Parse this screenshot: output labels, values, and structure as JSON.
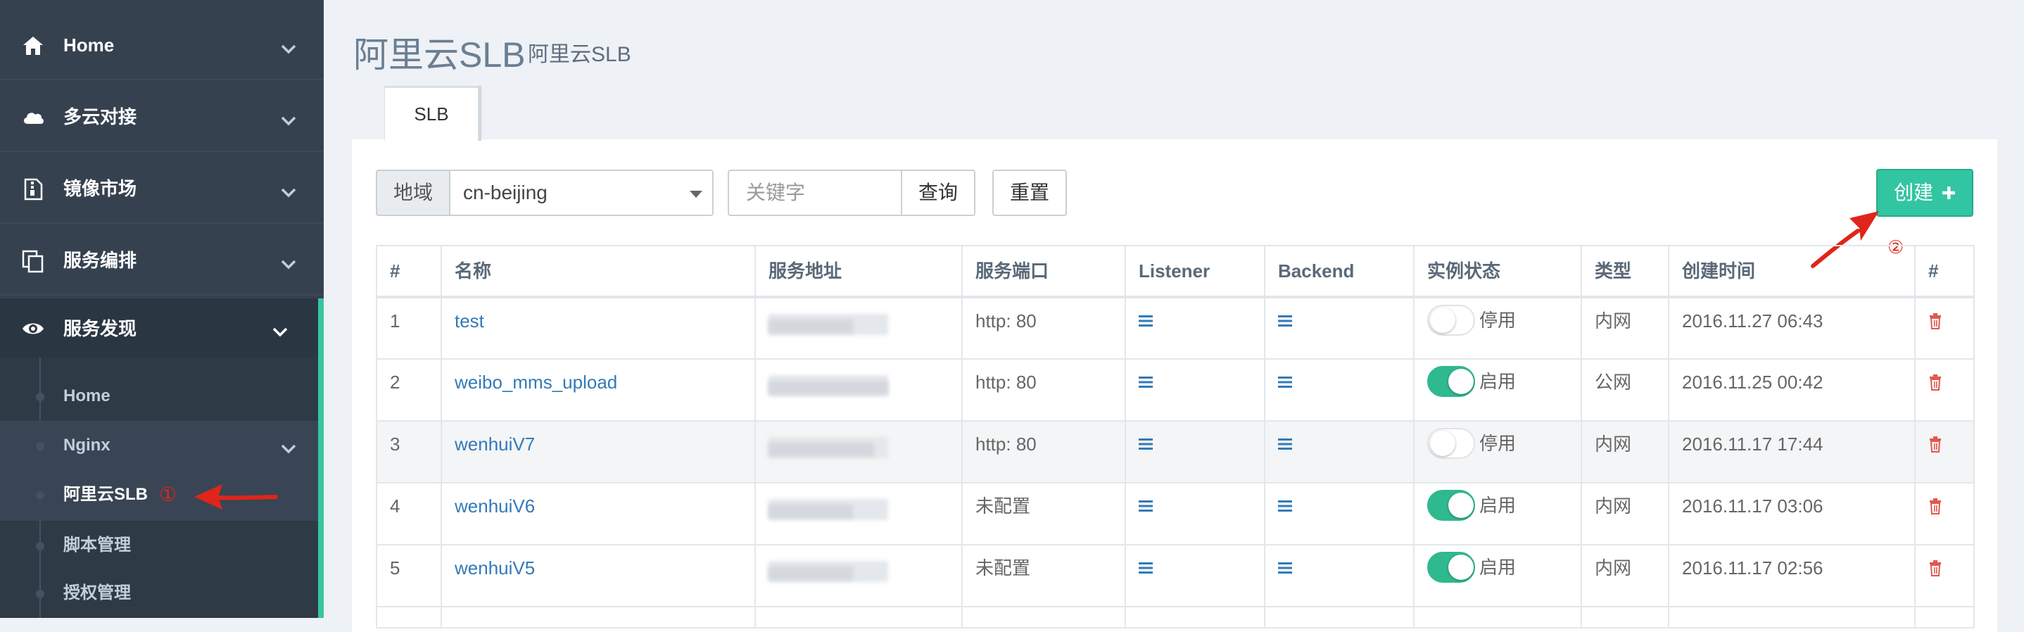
{
  "sidebar": {
    "items": [
      {
        "label": "Home",
        "icon": "home-icon"
      },
      {
        "label": "多云对接",
        "icon": "cloud-icon"
      },
      {
        "label": "镜像市场",
        "icon": "archive-icon"
      },
      {
        "label": "服务编排",
        "icon": "copy-icon"
      },
      {
        "label": "服务发现",
        "icon": "eye-icon"
      }
    ],
    "sub_items": [
      {
        "label": "Home"
      },
      {
        "label": "Nginx"
      },
      {
        "label": "阿里云SLB"
      },
      {
        "label": "脚本管理"
      },
      {
        "label": "授权管理"
      }
    ]
  },
  "annotations": {
    "marker1": "①",
    "marker2": "②"
  },
  "page": {
    "title": "阿里云SLB",
    "subtitle": "阿里云SLB"
  },
  "tabs": [
    {
      "label": "SLB"
    }
  ],
  "filters": {
    "region_label": "地域",
    "region_value": "cn-beijing",
    "keyword_placeholder": "关键字",
    "query_label": "查询",
    "reset_label": "重置",
    "create_label": "创建"
  },
  "table": {
    "headers": [
      "#",
      "名称",
      "服务地址",
      "服务端口",
      "Listener",
      "Backend",
      "实例状态",
      "类型",
      "创建时间",
      "#"
    ],
    "rows": [
      {
        "num": "1",
        "name": "test",
        "port": "http: 80",
        "status": "停用",
        "enabled": false,
        "type": "内网",
        "created": "2016.11.27 06:43"
      },
      {
        "num": "2",
        "name": "weibo_mms_upload",
        "port": "http: 80",
        "status": "启用",
        "enabled": true,
        "type": "公网",
        "created": "2016.11.25 00:42"
      },
      {
        "num": "3",
        "name": "wenhuiV7",
        "port": "http: 80",
        "status": "停用",
        "enabled": false,
        "type": "内网",
        "created": "2016.11.17 17:44"
      },
      {
        "num": "4",
        "name": "wenhuiV6",
        "port": "未配置",
        "status": "启用",
        "enabled": true,
        "type": "内网",
        "created": "2016.11.17 03:06"
      },
      {
        "num": "5",
        "name": "wenhuiV5",
        "port": "未配置",
        "status": "启用",
        "enabled": true,
        "type": "内网",
        "created": "2016.11.17 02:56"
      }
    ]
  },
  "colors": {
    "sidebar_bg": "#364150",
    "accent": "#32c5a2",
    "link": "#337ab7",
    "delete": "#e2584e",
    "annotation": "#e0251a"
  }
}
